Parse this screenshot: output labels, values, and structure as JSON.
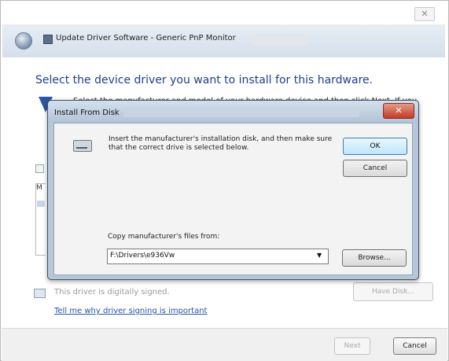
{
  "background_window": {
    "caption_partial": "",
    "close_glyph": "✕",
    "title": "Update Driver Software - Generic PnP Monitor",
    "heading": "Select the device driver you want to install for this hardware.",
    "instruction_partial": "Select the manufacturer and model of your hardware device and then click Next. If you",
    "instruction_tail": "you",
    "list_header_partial": "M",
    "unsigned_text": "This driver is digitally signed.",
    "signing_link": "Tell me why driver signing is important",
    "have_disk_label": "Have Disk...",
    "next_label": "Next",
    "cancel_label": "Cancel"
  },
  "dialog": {
    "title": "Install From Disk",
    "close_glyph": "✕",
    "instruction": "Insert the manufacturer's installation disk, and then make sure that the correct drive is selected below.",
    "ok_label": "OK",
    "cancel_label": "Cancel",
    "copy_label": "Copy manufacturer's files from:",
    "path_value": "F:\\Drivers\\e936Vw",
    "combo_arrow": "▼",
    "browse_label": "Browse..."
  },
  "icons": {
    "back": "back-arrow-icon",
    "monitor": "monitor-icon",
    "shield": "shield-icon",
    "disk": "disk-drive-icon",
    "unsigned": "driver-icon"
  }
}
